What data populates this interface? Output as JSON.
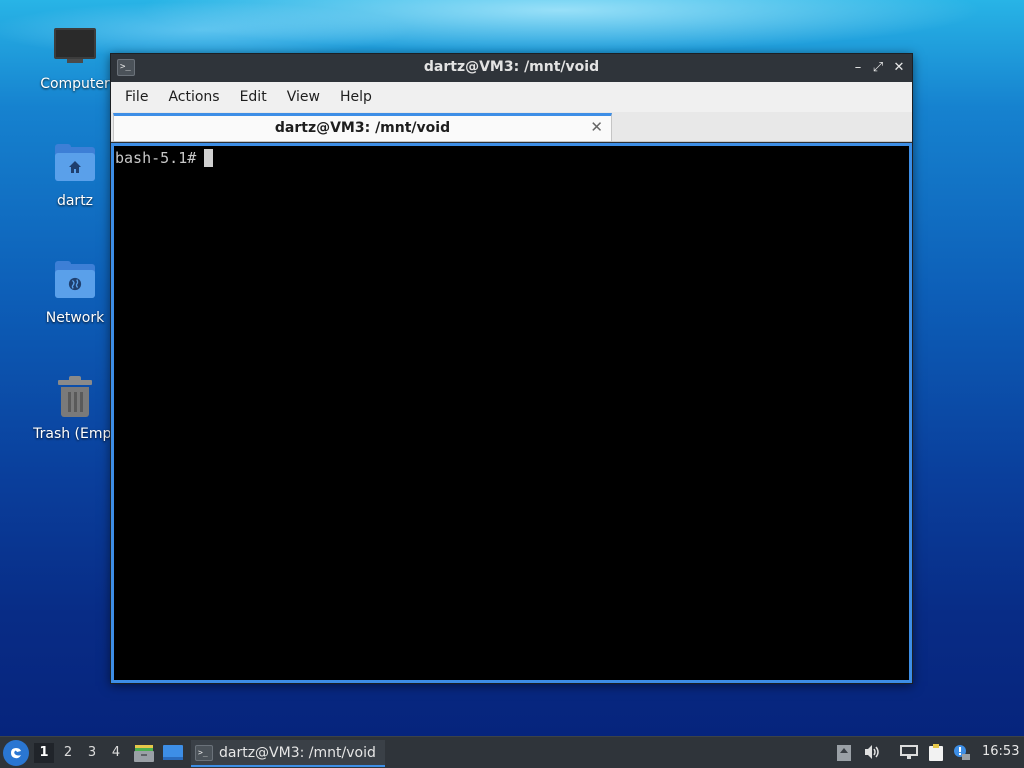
{
  "desktop": {
    "icons": [
      {
        "label": "Computer",
        "icon": "computer-icon"
      },
      {
        "label": "dartz",
        "icon": "home-folder-icon"
      },
      {
        "label": "Network",
        "icon": "network-folder-icon"
      },
      {
        "label": "Trash (Empt",
        "icon": "trash-icon"
      }
    ]
  },
  "window": {
    "title": "dartz@VM3: /mnt/void",
    "app_icon_text": ">_",
    "controls": {
      "minimize": "–",
      "maximize": "⤢",
      "close": "✕"
    },
    "menu": [
      "File",
      "Actions",
      "Edit",
      "View",
      "Help"
    ],
    "tab": {
      "title": "dartz@VM3: /mnt/void",
      "close": "✕"
    },
    "terminal": {
      "prompt": "bash-5.1#"
    }
  },
  "taskbar": {
    "start_icon": "start-menu-icon",
    "workspaces": [
      "1",
      "2",
      "3",
      "4"
    ],
    "active_workspace": "1",
    "task": {
      "label": "dartz@VM3: /mnt/void",
      "icon_text": ">_"
    },
    "clock": "16:53"
  },
  "colors": {
    "accent": "#3d8ee6",
    "titlebar": "#2f343a",
    "terminal_bg": "#000000",
    "terminal_fg": "#c8c8c8"
  }
}
